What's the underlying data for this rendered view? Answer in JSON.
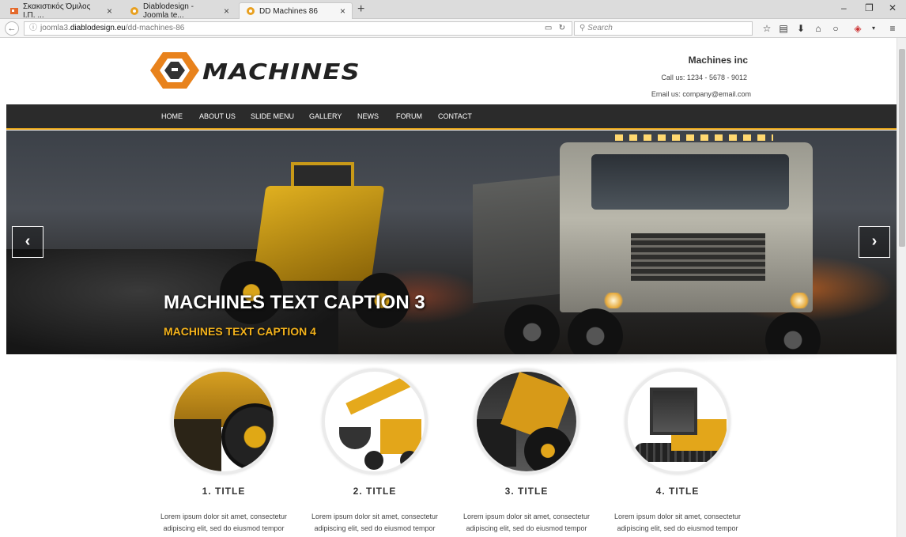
{
  "browser": {
    "tabs": [
      {
        "label": "Σκακιστικός Όμιλος Ι.Π. ...",
        "close": "×"
      },
      {
        "label": "Diablodesign - Joomla te...",
        "close": "×"
      },
      {
        "label": "DD Machines 86",
        "close": "×"
      }
    ],
    "new_tab": "+",
    "window_controls": {
      "minimize": "–",
      "restore": "❐",
      "close": "✕"
    },
    "url_prefix": "joomla3.",
    "url_domain": "diablodesign.eu",
    "url_path": "/dd-machines-86",
    "search_placeholder": "Search",
    "toolbar_icons": [
      "star-icon",
      "reader-icon",
      "download-icon",
      "home-icon",
      "chat-icon",
      "addon-icon",
      "menu-icon"
    ]
  },
  "header": {
    "logo_text": "MACHINES",
    "company": "Machines inc",
    "call": "Call us: 1234 - 5678 - 9012",
    "email": "Email us: company@email.com"
  },
  "nav": [
    "HOME",
    "ABOUT US",
    "SLIDE MENU",
    "GALLERY",
    "NEWS",
    "FORUM",
    "CONTACT"
  ],
  "slider": {
    "caption_main": "MACHINES TEXT CAPTION 3",
    "caption_sub": "MACHINES TEXT CAPTION 4",
    "prev": "‹",
    "next": "›"
  },
  "features": [
    {
      "title": "1. TITLE",
      "text": "Lorem ipsum dolor sit amet, consectetur adipiscing elit, sed do eiusmod tempor"
    },
    {
      "title": "2. TITLE",
      "text": "Lorem ipsum dolor sit amet, consectetur adipiscing elit, sed do eiusmod tempor"
    },
    {
      "title": "3. TITLE",
      "text": "Lorem ipsum dolor sit amet, consectetur adipiscing elit, sed do eiusmod tempor"
    },
    {
      "title": "4. TITLE",
      "text": "Lorem ipsum dolor sit amet, consectetur adipiscing elit, sed do eiusmod tempor"
    }
  ],
  "colors": {
    "accent": "#e3a31a",
    "nav_bg": "#2b2b2b",
    "caption_sub": "#f2b11b"
  }
}
